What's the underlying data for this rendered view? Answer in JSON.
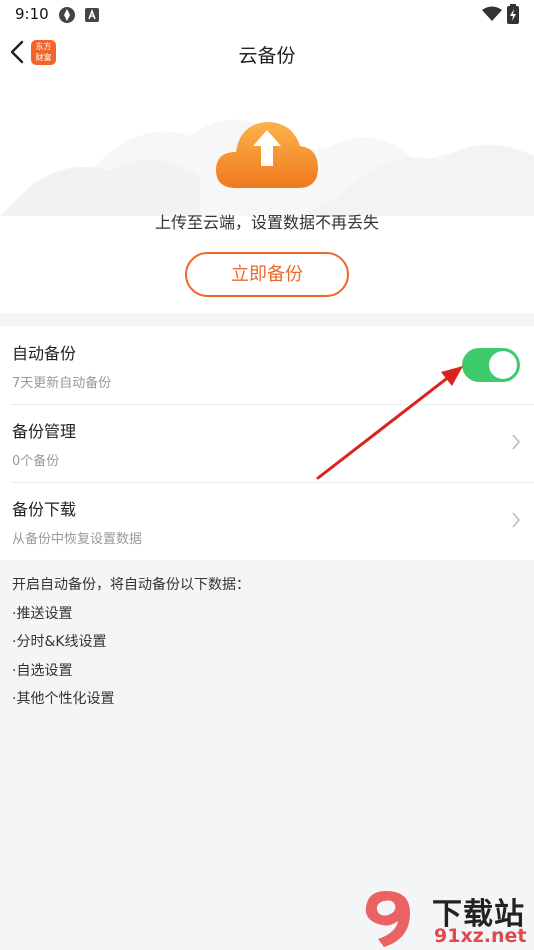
{
  "status_bar": {
    "time": "9:10"
  },
  "header": {
    "title": "云备份",
    "logo_text_line1": "东方",
    "logo_text_line2": "财富"
  },
  "hero": {
    "description": "上传至云端，设置数据不再丢失",
    "backup_now_label": "立即备份"
  },
  "settings": {
    "auto_backup": {
      "title": "自动备份",
      "subtitle": "7天更新自动备份",
      "enabled": true
    },
    "backup_manage": {
      "title": "备份管理",
      "subtitle": "0个备份"
    },
    "backup_download": {
      "title": "备份下载",
      "subtitle": "从备份中恢复设置数据"
    }
  },
  "info": {
    "intro": "开启自动备份，将自动备份以下数据：",
    "items": [
      "·推送设置",
      "·分时&K线设置",
      "·自选设置",
      "·其他个性化设置"
    ]
  },
  "watermark": {
    "text_top": "下载站",
    "text_bottom": "91xz.net"
  },
  "colors": {
    "accent": "#ec6a2c",
    "toggle_on": "#3ecb6e",
    "annotation_arrow": "#d9231f"
  }
}
